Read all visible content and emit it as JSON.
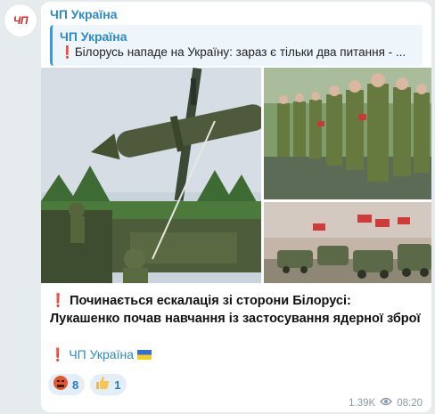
{
  "channel": {
    "avatar_text": "ЧП",
    "name": "ЧП Україна"
  },
  "reply": {
    "title": "ЧП Україна",
    "text": "Білорусь нападе на Україну: зараз є тільки два питання - ..."
  },
  "message": {
    "text": "Починається ескалація зі сторони Білорусі: Лукашенко почав навчання із застосування ядерної зброї",
    "signature": "ЧП Україна",
    "signature_flag": "ukraine-flag-icon",
    "views": "1.39K",
    "time": "08:20"
  },
  "reactions": [
    {
      "icon": "angry-face-icon",
      "count": "8"
    },
    {
      "icon": "thumbs-up-icon",
      "count": "1"
    }
  ],
  "colors": {
    "accent": "#2b8ac7",
    "exclamation": "#e0262a"
  }
}
